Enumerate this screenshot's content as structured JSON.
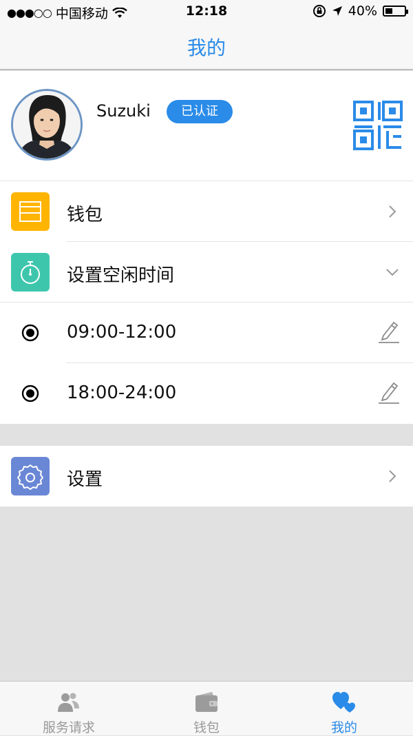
{
  "status_bar": {
    "signal": "●●●○○",
    "carrier": "中国移动",
    "time": "12:18",
    "battery_percent": "40%",
    "battery_level": 0.4
  },
  "header": {
    "title": "我的"
  },
  "profile": {
    "username": "Suzuki",
    "verified_label": "已认证"
  },
  "menu": {
    "wallet_label": "钱包",
    "idle_time_label": "设置空闲时间",
    "time_slots": [
      "09:00-12:00",
      "18:00-24:00"
    ],
    "settings_label": "设置"
  },
  "tabs": [
    {
      "label": "服务请求",
      "icon": "users-icon",
      "active": false
    },
    {
      "label": "钱包",
      "icon": "wallet-icon",
      "active": false
    },
    {
      "label": "我的",
      "icon": "hearts-icon",
      "active": true
    }
  ],
  "colors": {
    "accent": "#2a8be8",
    "wallet_icon_bg": "#ffb400",
    "timer_icon_bg": "#3ec6ad",
    "settings_icon_bg": "#6a87d6",
    "background": "#e1e1e1"
  }
}
